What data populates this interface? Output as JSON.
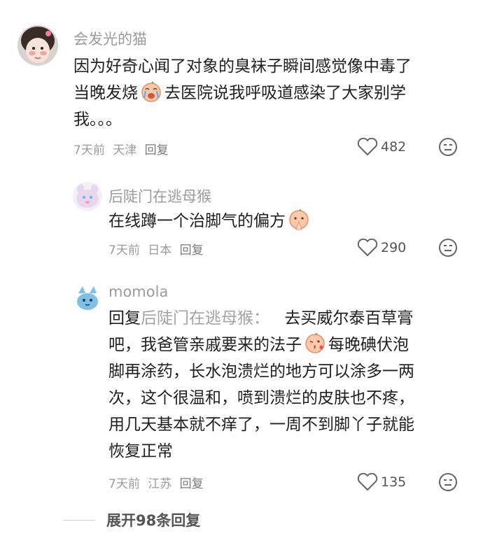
{
  "comments": [
    {
      "username": "会发光的猫",
      "text_lines": [
        "因为好奇心闻了对象的臭袜子瞬间感觉像中毒了",
        "当晚发烧",
        "去医院说我呼吸道感染了大家别学",
        "我。。。"
      ],
      "time": "7天前",
      "location": "天津",
      "reply_label": "回复",
      "likes": "482",
      "avatar_icon": "girl-avatar-icon",
      "inline_emoji": "crying-emoji-icon"
    },
    {
      "username": "后陡门在逃母猴",
      "text_lines": [
        "在线蹲一个治脚气的偏方"
      ],
      "time": "7天前",
      "location": "日本",
      "reply_label": "回复",
      "likes": "290",
      "avatar_icon": "pink-cartoon-avatar-icon",
      "inline_emoji": "praying-emoji-icon"
    },
    {
      "username": "momola",
      "reply_prefix": "回复",
      "reply_target": "后陡门在逃母猴：",
      "text_lines": [
        "去买威尔泰百草膏",
        "吧，我爸管亲戚要来的法子",
        "每晚碘伏泡",
        "脚再涂药，长水泡溃烂的地方可以涂多一两",
        "次，这个很温和，喷到溃烂的皮肤也不疼，",
        "用几天基本就不痒了，一周不到脚丫子就能",
        "恢复正常"
      ],
      "time": "7天前",
      "location": "江苏",
      "reply_label": "回复",
      "likes": "135",
      "avatar_icon": "blue-cartoon-avatar-icon",
      "inline_emoji": "kiss-emoji-icon"
    }
  ],
  "expand_label": "展开98条回复",
  "colors": {
    "meta": "#9b9b9b",
    "text": "#1f1f1f",
    "icon": "#666666"
  }
}
